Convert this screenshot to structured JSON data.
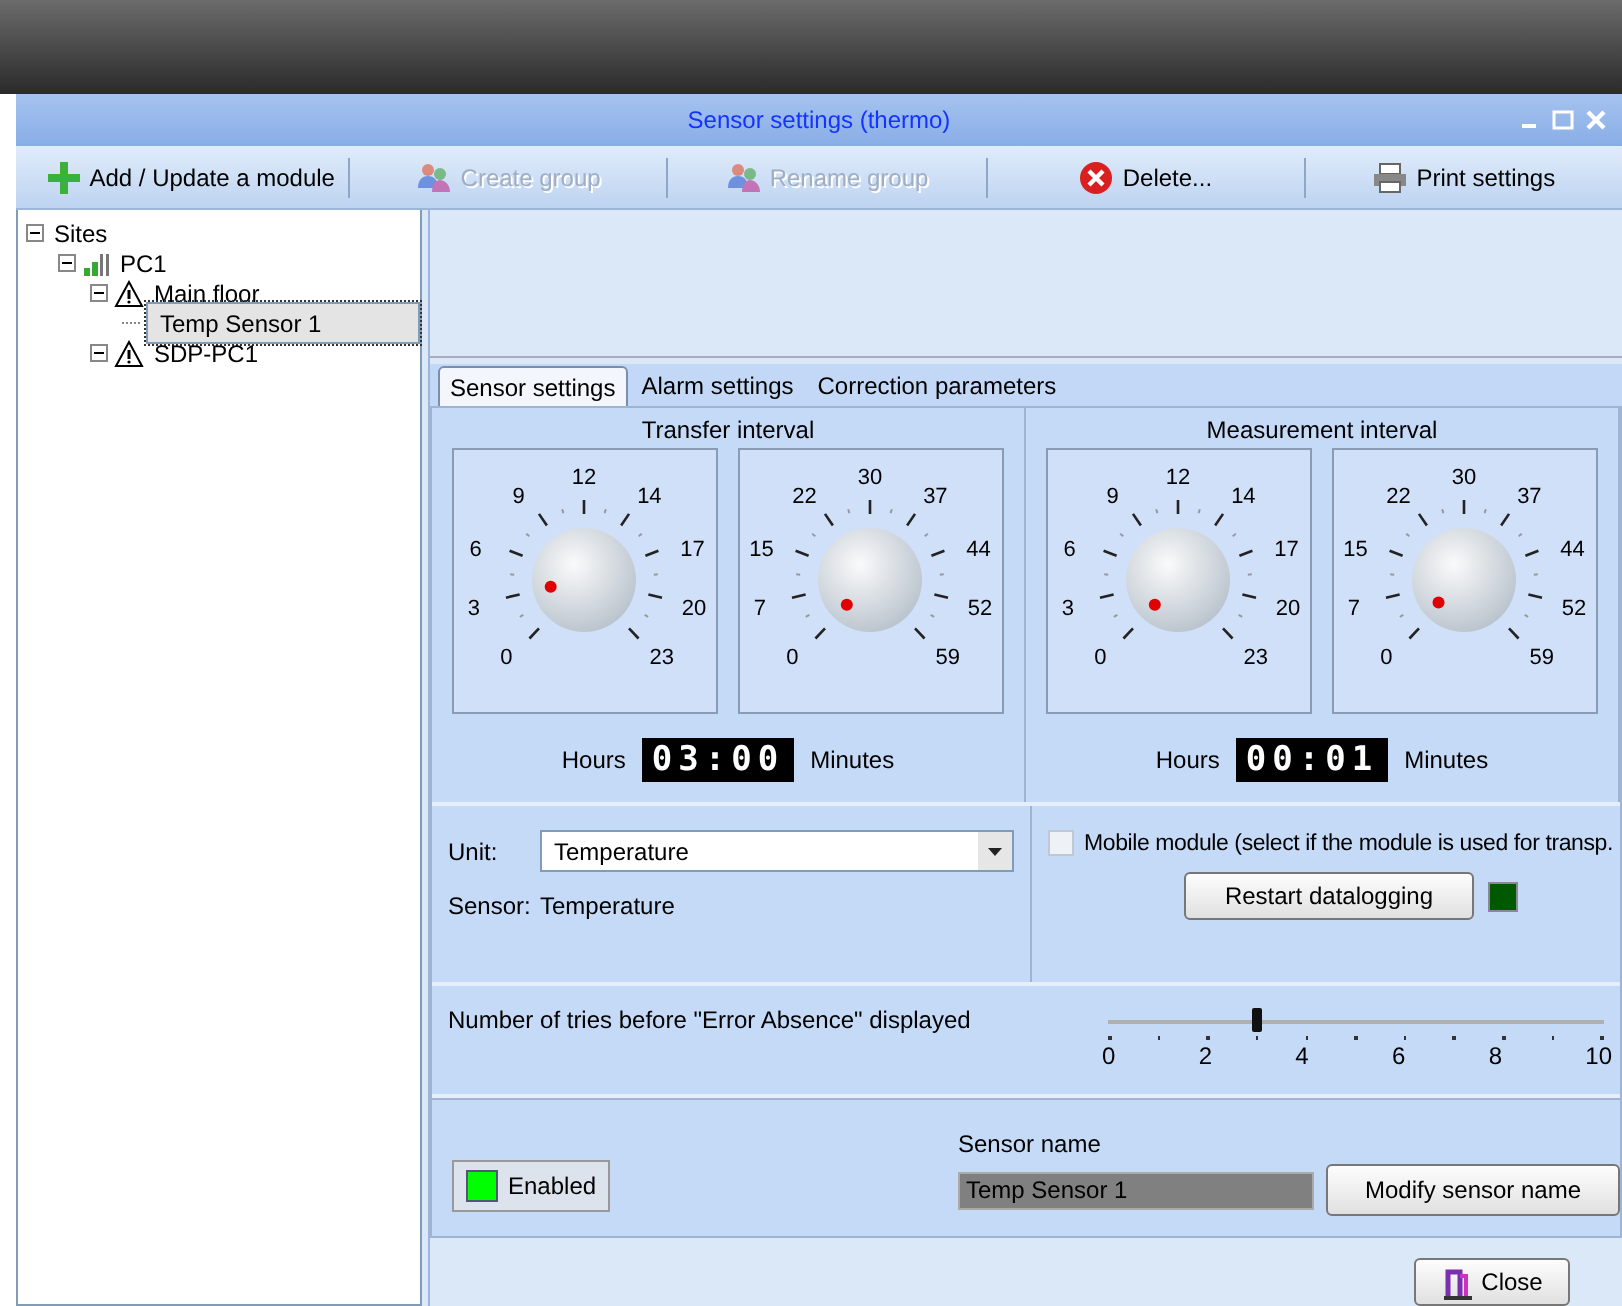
{
  "window": {
    "title": "Sensor settings (thermo)"
  },
  "toolbar": [
    {
      "label": "Add / Update a module",
      "kind": "add",
      "disabled": false
    },
    {
      "label": "Create group",
      "kind": "group",
      "disabled": true
    },
    {
      "label": "Rename group",
      "kind": "group",
      "disabled": true
    },
    {
      "label": "Delete...",
      "kind": "delete",
      "disabled": false
    },
    {
      "label": "Print settings",
      "kind": "print",
      "disabled": false
    }
  ],
  "tree": [
    {
      "label": "Sites",
      "expanded": true,
      "selected": false,
      "children": [
        {
          "label": "PC1",
          "kind": "computer",
          "expanded": true,
          "selected": false,
          "children": [
            {
              "label": "Main floor",
              "kind": "site",
              "expanded": true,
              "selected": false,
              "children": [
                {
                  "label": "Temp Sensor 1",
                  "selected": true
                }
              ]
            },
            {
              "label": "SDP-PC1",
              "kind": "site",
              "expanded": true,
              "selected": false
            }
          ]
        }
      ]
    }
  ],
  "tabs": [
    {
      "label": "Sensor settings",
      "selected": true
    },
    {
      "label": "Alarm settings",
      "selected": false
    },
    {
      "label": "Correction parameters",
      "selected": false
    }
  ],
  "intervals": [
    {
      "title": "Transfer interval",
      "dials": [
        {
          "labels": [
            "0",
            "3",
            "6",
            "9",
            "12",
            "14",
            "17",
            "20",
            "23"
          ]
        },
        {
          "labels": [
            "0",
            "7",
            "15",
            "22",
            "30",
            "37",
            "44",
            "52",
            "59"
          ]
        }
      ],
      "hours_label": "Hours",
      "display": "03:00",
      "minutes_label": "Minutes"
    },
    {
      "title": "Measurement interval",
      "dials": [
        {
          "labels": [
            "0",
            "3",
            "6",
            "9",
            "12",
            "14",
            "17",
            "20",
            "23"
          ]
        },
        {
          "labels": [
            "0",
            "7",
            "15",
            "22",
            "30",
            "37",
            "44",
            "52",
            "59"
          ]
        }
      ],
      "hours_label": "Hours",
      "display": "00:01",
      "minutes_label": "Minutes"
    }
  ],
  "unit": {
    "label": "Unit:",
    "value": "Temperature"
  },
  "sensor": {
    "label": "Sensor:",
    "value": "Temperature"
  },
  "mobile_module": {
    "label": "Mobile module  (select if the module is used for transp.",
    "checked": false
  },
  "restart_button": {
    "label": "Restart datalogging",
    "indicator_on": true
  },
  "tries": {
    "label": "Number of tries before \"Error Absence\" displayed",
    "level": 0.3,
    "ticks": [
      "0",
      "2",
      "4",
      "6",
      "8",
      "10"
    ]
  },
  "enabled_button": {
    "label": "Enabled",
    "on": true
  },
  "sensor_name": {
    "label": "Sensor name",
    "value": "Temp Sensor 1"
  },
  "modify_button": "Modify sensor name",
  "close_button": "Close"
}
